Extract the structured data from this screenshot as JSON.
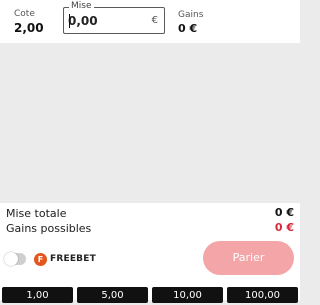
{
  "odds": {
    "label": "Cote",
    "value": "2,00"
  },
  "stake": {
    "label": "Mise",
    "value": "0,00",
    "currency": "€"
  },
  "winnings": {
    "label": "Gains",
    "value": "0 €"
  },
  "summary": {
    "total_stake_label": "Mise totale",
    "total_stake_value": "0 €",
    "possible_winnings_label": "Gains possibles",
    "possible_winnings_value": "0 €"
  },
  "freebet": {
    "icon_letter": "F",
    "label": "FREEBET",
    "toggle_on": false
  },
  "bet_button": {
    "label": "Parier"
  },
  "quick_amounts": [
    "1,00",
    "5,00",
    "10,00",
    "100,00"
  ],
  "colors": {
    "accent_red": "#d8263a",
    "bet_button_disabled": "#f3a5a8",
    "freebet_orange": "#e3571f"
  }
}
